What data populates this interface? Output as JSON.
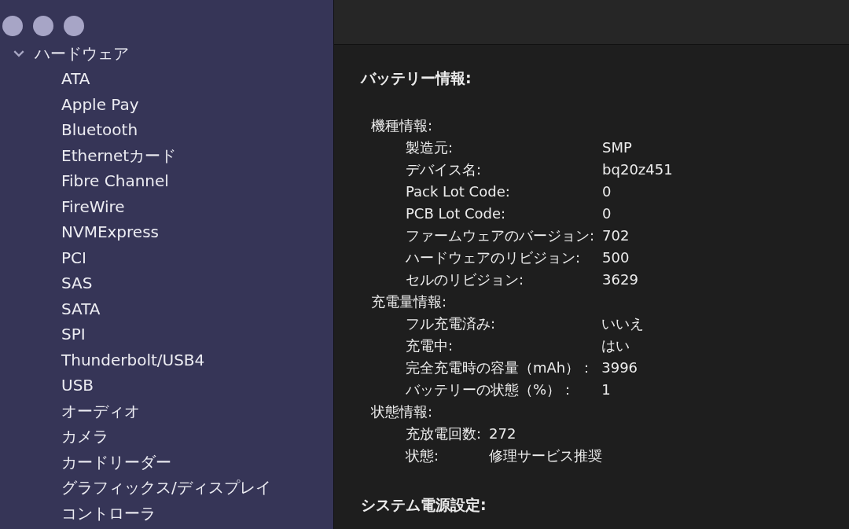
{
  "sidebar": {
    "items": [
      {
        "label": "ハードウェア",
        "expanded": true,
        "children": [
          {
            "label": "ATA"
          },
          {
            "label": "Apple Pay"
          },
          {
            "label": "Bluetooth"
          },
          {
            "label": "Ethernetカード"
          },
          {
            "label": "Fibre Channel"
          },
          {
            "label": "FireWire"
          },
          {
            "label": "NVMExpress"
          },
          {
            "label": "PCI"
          },
          {
            "label": "SAS"
          },
          {
            "label": "SATA"
          },
          {
            "label": "SPI"
          },
          {
            "label": "Thunderbolt/USB4"
          },
          {
            "label": "USB"
          },
          {
            "label": "オーディオ"
          },
          {
            "label": "カメラ"
          },
          {
            "label": "カードリーダー"
          },
          {
            "label": "グラフィックス/ディスプレイ"
          },
          {
            "label": "コントローラ"
          }
        ]
      }
    ]
  },
  "detail": {
    "sections": [
      {
        "title": "バッテリー情報:",
        "groups": [
          {
            "title": "機種情報:",
            "rows": [
              {
                "label": "製造元:",
                "value": "SMP"
              },
              {
                "label": "デバイス名:",
                "value": "bq20z451"
              },
              {
                "label": "Pack Lot Code:",
                "value": "0"
              },
              {
                "label": "PCB Lot Code:",
                "value": "0"
              },
              {
                "label": "ファームウェアのバージョン:",
                "value": "702"
              },
              {
                "label": "ハードウェアのリビジョン:",
                "value": "500"
              },
              {
                "label": "セルのリビジョン:",
                "value": "3629"
              }
            ]
          },
          {
            "title": "充電量情報:",
            "rows": [
              {
                "label": "フル充電済み:",
                "value": "いいえ"
              },
              {
                "label": "充電中:",
                "value": "はい"
              },
              {
                "label": "完全充電時の容量（mAh）：",
                "value": "3996"
              },
              {
                "label": "バッテリーの状態（%）：",
                "value": "1"
              }
            ]
          },
          {
            "title": "状態情報:",
            "rows": [
              {
                "label": "充放電回数:",
                "value": "272"
              },
              {
                "label": "状態:",
                "value": "修理サービス推奨"
              }
            ]
          }
        ]
      },
      {
        "title": "システム電源設定:"
      }
    ]
  }
}
